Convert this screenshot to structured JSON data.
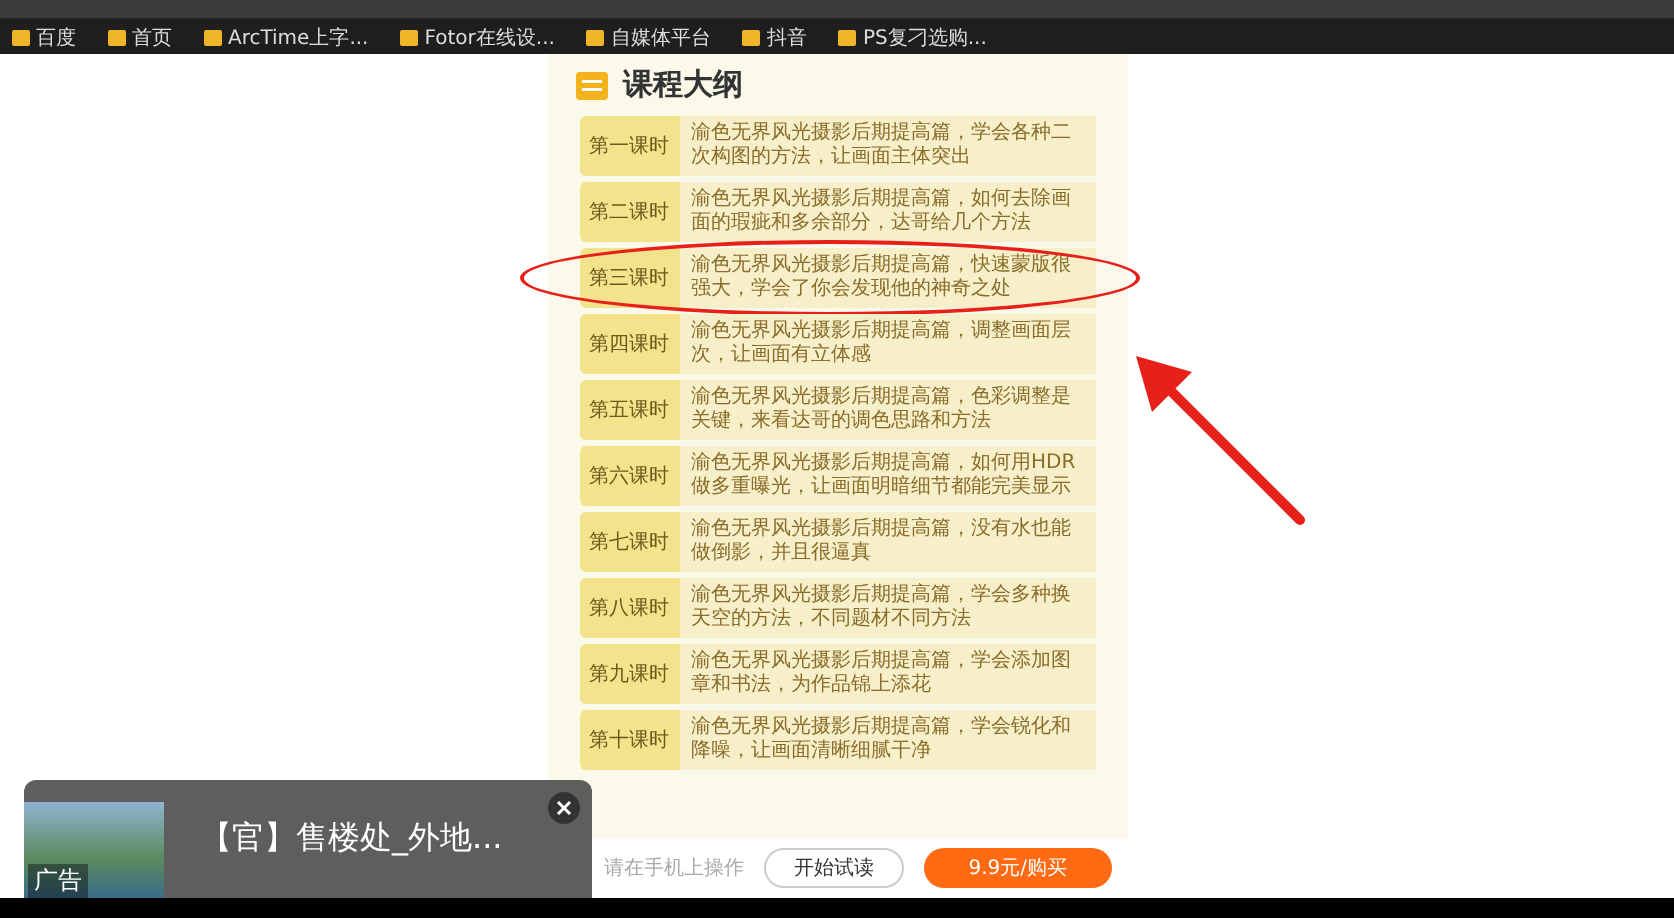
{
  "bookmarks": [
    {
      "label": "百度"
    },
    {
      "label": "首页"
    },
    {
      "label": "ArcTime上字..."
    },
    {
      "label": "Fotor在线设..."
    },
    {
      "label": "自媒体平台"
    },
    {
      "label": "抖音"
    },
    {
      "label": "PS复刁选购..."
    }
  ],
  "course": {
    "title": "课程大纲",
    "lessons": [
      {
        "label": "第一课时",
        "text": "渝色无界风光摄影后期提高篇，学会各种二次构图的方法，让画面主体突出",
        "circled": false
      },
      {
        "label": "第二课时",
        "text": "渝色无界风光摄影后期提高篇，如何去除画面的瑕疵和多余部分，达哥给几个方法",
        "circled": false
      },
      {
        "label": "第三课时",
        "text": "渝色无界风光摄影后期提高篇，快速蒙版很强大，学会了你会发现他的神奇之处",
        "circled": true
      },
      {
        "label": "第四课时",
        "text": "渝色无界风光摄影后期提高篇，调整画面层次，让画面有立体感",
        "circled": false
      },
      {
        "label": "第五课时",
        "text": "渝色无界风光摄影后期提高篇，色彩调整是关键，来看达哥的调色思路和方法",
        "circled": false
      },
      {
        "label": "第六课时",
        "text": "渝色无界风光摄影后期提高篇，如何用HDR做多重曝光，让画面明暗细节都能完美显示",
        "circled": false
      },
      {
        "label": "第七课时",
        "text": "渝色无界风光摄影后期提高篇，没有水也能做倒影，并且很逼真",
        "circled": false
      },
      {
        "label": "第八课时",
        "text": "渝色无界风光摄影后期提高篇，学会多种换天空的方法，不同题材不同方法",
        "circled": false
      },
      {
        "label": "第九课时",
        "text": "渝色无界风光摄影后期提高篇，学会添加图章和书法，为作品锦上添花",
        "circled": false
      },
      {
        "label": "第十课时",
        "text": "渝色无界风光摄影后期提高篇，学会锐化和降噪，让画面清晰细腻干净",
        "circled": false
      }
    ],
    "footer": {
      "hint": "请在手机上操作",
      "trial_button": "开始试读",
      "buy_button": "9.9元/购买"
    }
  },
  "ad": {
    "title": "【官】售楼处_外地...",
    "badge": "广告"
  }
}
